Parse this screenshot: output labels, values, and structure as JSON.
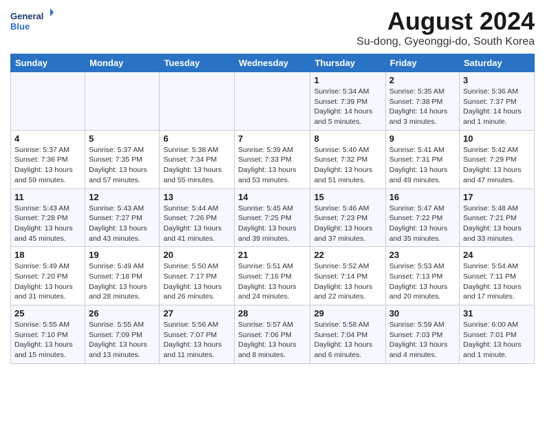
{
  "logo": {
    "line1": "General",
    "line2": "Blue"
  },
  "title": "August 2024",
  "subtitle": "Su-dong, Gyeonggi-do, South Korea",
  "weekdays": [
    "Sunday",
    "Monday",
    "Tuesday",
    "Wednesday",
    "Thursday",
    "Friday",
    "Saturday"
  ],
  "weeks": [
    [
      {
        "day": "",
        "content": ""
      },
      {
        "day": "",
        "content": ""
      },
      {
        "day": "",
        "content": ""
      },
      {
        "day": "",
        "content": ""
      },
      {
        "day": "1",
        "content": "Sunrise: 5:34 AM\nSunset: 7:39 PM\nDaylight: 14 hours\nand 5 minutes."
      },
      {
        "day": "2",
        "content": "Sunrise: 5:35 AM\nSunset: 7:38 PM\nDaylight: 14 hours\nand 3 minutes."
      },
      {
        "day": "3",
        "content": "Sunrise: 5:36 AM\nSunset: 7:37 PM\nDaylight: 14 hours\nand 1 minute."
      }
    ],
    [
      {
        "day": "4",
        "content": "Sunrise: 5:37 AM\nSunset: 7:36 PM\nDaylight: 13 hours\nand 59 minutes."
      },
      {
        "day": "5",
        "content": "Sunrise: 5:37 AM\nSunset: 7:35 PM\nDaylight: 13 hours\nand 57 minutes."
      },
      {
        "day": "6",
        "content": "Sunrise: 5:38 AM\nSunset: 7:34 PM\nDaylight: 13 hours\nand 55 minutes."
      },
      {
        "day": "7",
        "content": "Sunrise: 5:39 AM\nSunset: 7:33 PM\nDaylight: 13 hours\nand 53 minutes."
      },
      {
        "day": "8",
        "content": "Sunrise: 5:40 AM\nSunset: 7:32 PM\nDaylight: 13 hours\nand 51 minutes."
      },
      {
        "day": "9",
        "content": "Sunrise: 5:41 AM\nSunset: 7:31 PM\nDaylight: 13 hours\nand 49 minutes."
      },
      {
        "day": "10",
        "content": "Sunrise: 5:42 AM\nSunset: 7:29 PM\nDaylight: 13 hours\nand 47 minutes."
      }
    ],
    [
      {
        "day": "11",
        "content": "Sunrise: 5:43 AM\nSunset: 7:28 PM\nDaylight: 13 hours\nand 45 minutes."
      },
      {
        "day": "12",
        "content": "Sunrise: 5:43 AM\nSunset: 7:27 PM\nDaylight: 13 hours\nand 43 minutes."
      },
      {
        "day": "13",
        "content": "Sunrise: 5:44 AM\nSunset: 7:26 PM\nDaylight: 13 hours\nand 41 minutes."
      },
      {
        "day": "14",
        "content": "Sunrise: 5:45 AM\nSunset: 7:25 PM\nDaylight: 13 hours\nand 39 minutes."
      },
      {
        "day": "15",
        "content": "Sunrise: 5:46 AM\nSunset: 7:23 PM\nDaylight: 13 hours\nand 37 minutes."
      },
      {
        "day": "16",
        "content": "Sunrise: 5:47 AM\nSunset: 7:22 PM\nDaylight: 13 hours\nand 35 minutes."
      },
      {
        "day": "17",
        "content": "Sunrise: 5:48 AM\nSunset: 7:21 PM\nDaylight: 13 hours\nand 33 minutes."
      }
    ],
    [
      {
        "day": "18",
        "content": "Sunrise: 5:49 AM\nSunset: 7:20 PM\nDaylight: 13 hours\nand 31 minutes."
      },
      {
        "day": "19",
        "content": "Sunrise: 5:49 AM\nSunset: 7:18 PM\nDaylight: 13 hours\nand 28 minutes."
      },
      {
        "day": "20",
        "content": "Sunrise: 5:50 AM\nSunset: 7:17 PM\nDaylight: 13 hours\nand 26 minutes."
      },
      {
        "day": "21",
        "content": "Sunrise: 5:51 AM\nSunset: 7:16 PM\nDaylight: 13 hours\nand 24 minutes."
      },
      {
        "day": "22",
        "content": "Sunrise: 5:52 AM\nSunset: 7:14 PM\nDaylight: 13 hours\nand 22 minutes."
      },
      {
        "day": "23",
        "content": "Sunrise: 5:53 AM\nSunset: 7:13 PM\nDaylight: 13 hours\nand 20 minutes."
      },
      {
        "day": "24",
        "content": "Sunrise: 5:54 AM\nSunset: 7:11 PM\nDaylight: 13 hours\nand 17 minutes."
      }
    ],
    [
      {
        "day": "25",
        "content": "Sunrise: 5:55 AM\nSunset: 7:10 PM\nDaylight: 13 hours\nand 15 minutes."
      },
      {
        "day": "26",
        "content": "Sunrise: 5:55 AM\nSunset: 7:09 PM\nDaylight: 13 hours\nand 13 minutes."
      },
      {
        "day": "27",
        "content": "Sunrise: 5:56 AM\nSunset: 7:07 PM\nDaylight: 13 hours\nand 11 minutes."
      },
      {
        "day": "28",
        "content": "Sunrise: 5:57 AM\nSunset: 7:06 PM\nDaylight: 13 hours\nand 8 minutes."
      },
      {
        "day": "29",
        "content": "Sunrise: 5:58 AM\nSunset: 7:04 PM\nDaylight: 13 hours\nand 6 minutes."
      },
      {
        "day": "30",
        "content": "Sunrise: 5:59 AM\nSunset: 7:03 PM\nDaylight: 13 hours\nand 4 minutes."
      },
      {
        "day": "31",
        "content": "Sunrise: 6:00 AM\nSunset: 7:01 PM\nDaylight: 13 hours\nand 1 minute."
      }
    ]
  ]
}
